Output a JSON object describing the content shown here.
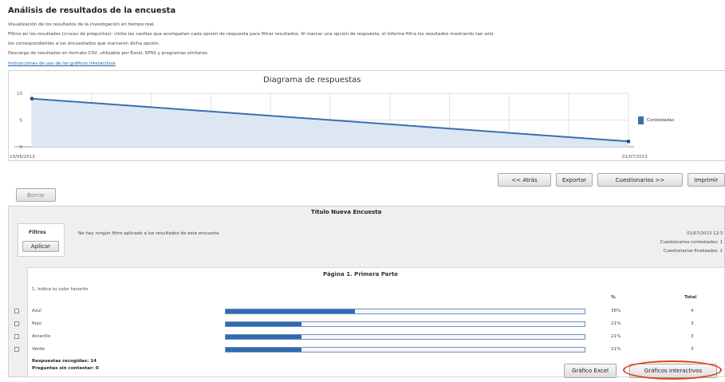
{
  "header": {
    "title": "Análisis de resultados de la encuesta",
    "desc_lines": [
      "Visualización de los resultados de la investigación en tiempo real.",
      "Filtros en los resultados (cruces de preguntas): clicke las casillas que acompañan cada opción de respuesta para filtrar resultados. Al marcar una opción de respuesta, el informe filtra los resultados mostrando tan solo",
      "los correspondientes a los encuestados que marcaron dicha opción.",
      "Descarga de resultados en formato CSV, utilizable por Excel, SPSS y programas similares."
    ],
    "link": "Instrucciones de uso de los gráficos interactivos"
  },
  "chart_data": {
    "type": "area",
    "title": "Diagrama de respuestas",
    "x": [
      "19/06/2013",
      "01/07/2013"
    ],
    "series": [
      {
        "name": "Contestadas",
        "values": [
          9,
          1
        ]
      }
    ],
    "ylim": [
      0,
      10
    ],
    "yticks": [
      "10",
      "5",
      "0"
    ],
    "grid": true,
    "legend": "right",
    "color": "#3a6fb0"
  },
  "toolbar": {
    "back": "<< Atrás",
    "export": "Exportar",
    "questionnaires": "Cuestionarios >>",
    "print": "Imprimir",
    "reset": "Borrar"
  },
  "survey": {
    "title": "Título Nueva Encuesta",
    "filters_label": "Filtros",
    "apply": "Aplicar",
    "no_filter": "No hay ningún filtro aplicado a los resultados de esta encuesta",
    "date": "01/07/2013 12:3",
    "answered": "Cuestionarios contestados: 1",
    "finished": "Cuestionarios finalizados: 1"
  },
  "page": {
    "title": "Página 1. Primera Parte",
    "question": "1. Indica tu color favorito",
    "col_pct": "%",
    "col_total": "Total",
    "rows": [
      {
        "label": "Azul",
        "fraction": 0.36,
        "pct": "36%",
        "total": "4"
      },
      {
        "label": "Rojo",
        "fraction": 0.21,
        "pct": "21%",
        "total": "3"
      },
      {
        "label": "Amarillo",
        "fraction": 0.21,
        "pct": "21%",
        "total": "3"
      },
      {
        "label": "Verde",
        "fraction": 0.21,
        "pct": "21%",
        "total": "3"
      }
    ],
    "responses": "Respuestas recogidas: 14",
    "unanswered": "Preguntas sin contestar: 0",
    "excel_button": "Gráfico Excel",
    "interactive_button": "Gráficos interactivos"
  }
}
